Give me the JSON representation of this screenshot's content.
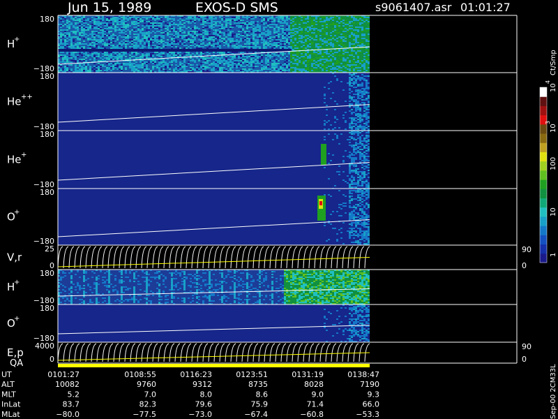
{
  "header": {
    "date": "Jun 15, 1989",
    "instrument": "EXOS-D SMS",
    "file": "s9061407.asr",
    "time": "01:01:27"
  },
  "colorbar": {
    "unit": "Ct/Smp",
    "ticks": [
      "1",
      "10",
      "100",
      "10",
      "10"
    ],
    "tick_exponents": [
      "",
      "",
      "",
      "3",
      "4"
    ],
    "colors": [
      "#1a1a8a",
      "#1530a8",
      "#1450c0",
      "#1478c8",
      "#18a0c8",
      "#20c0c0",
      "#10a878",
      "#109040",
      "#20a020",
      "#60c020",
      "#a0d020",
      "#e0e010",
      "#c0a020",
      "#8a6a10",
      "#6a4a10",
      "#e01010",
      "#a01010",
      "#601010",
      "#ffffff"
    ],
    "highlight_colors": [
      "#ffffff"
    ]
  },
  "panels": [
    {
      "species": "H",
      "charge": "+",
      "y_top": "180",
      "y_bottom": "−180",
      "kind": "spectrogram",
      "base_color": "#1a58a8"
    },
    {
      "species": "He",
      "charge": "++",
      "y_top": "180",
      "y_bottom": "−180",
      "kind": "spectrogram",
      "base_color": "#16268a"
    },
    {
      "species": "He",
      "charge": "+",
      "y_top": "180",
      "y_bottom": "−180",
      "kind": "spectrogram",
      "base_color": "#16268a"
    },
    {
      "species": "O",
      "charge": "+",
      "y_top": "180",
      "y_bottom": "−180",
      "kind": "spectrogram",
      "base_color": "#16268a"
    },
    {
      "species": "V,r",
      "charge": "",
      "y_top": "25",
      "y_bottom": "0",
      "right_top": "90",
      "right_bottom": "0",
      "kind": "lines"
    },
    {
      "species": "H",
      "charge": "+",
      "y_top": "180",
      "y_bottom": "−180",
      "kind": "spectrogram",
      "base_color": "#1c3c98"
    },
    {
      "species": "O",
      "charge": "+",
      "y_top": "180",
      "y_bottom": "−180",
      "kind": "spectrogram",
      "base_color": "#16268a"
    },
    {
      "species": "E,p",
      "charge": "",
      "y_top": "4000",
      "y_bottom": "0",
      "right_top": "90",
      "right_bottom": "0",
      "kind": "lines"
    }
  ],
  "qa_label": "QA",
  "side_label": "Sep-00 2CM33L",
  "orbit_table": {
    "rows": [
      {
        "label": "UT",
        "values": [
          "0101:27",
          "0108:55",
          "0116:23",
          "0123:51",
          "0131:19",
          "0138:47"
        ]
      },
      {
        "label": "ALT",
        "values": [
          "10082",
          "9760",
          "9312",
          "8735",
          "8028",
          "7190"
        ]
      },
      {
        "label": "MLT",
        "values": [
          "5.2",
          "7.0",
          "8.0",
          "8.6",
          "9.0",
          "9.3"
        ]
      },
      {
        "label": "InLat",
        "values": [
          "83.7",
          "82.3",
          "79.6",
          "75.9",
          "71.4",
          "66.0"
        ]
      },
      {
        "label": "MLat",
        "values": [
          "−80.0",
          "−77.5",
          "−73.0",
          "−67.4",
          "−60.8",
          "−53.3"
        ]
      }
    ]
  },
  "chart_data": {
    "type": "heatmap",
    "title": "Jun 15, 1989   EXOS-D SMS",
    "x": [
      "0101:27",
      "0108:55",
      "0116:23",
      "0123:51",
      "0131:19",
      "0138:47"
    ],
    "series": [
      {
        "name": "H+",
        "ylim": [
          -180,
          180
        ]
      },
      {
        "name": "He++",
        "ylim": [
          -180,
          180
        ]
      },
      {
        "name": "He+",
        "ylim": [
          -180,
          180
        ]
      },
      {
        "name": "O+",
        "ylim": [
          -180,
          180
        ]
      },
      {
        "name": "V,r",
        "ylim": [
          0,
          25
        ]
      },
      {
        "name": "H+",
        "ylim": [
          -180,
          180
        ]
      },
      {
        "name": "O+",
        "ylim": [
          -180,
          180
        ]
      },
      {
        "name": "E,p",
        "ylim": [
          0,
          4000
        ]
      }
    ],
    "colorbar_unit": "Ct/Smp",
    "colorbar_scale": "log"
  }
}
